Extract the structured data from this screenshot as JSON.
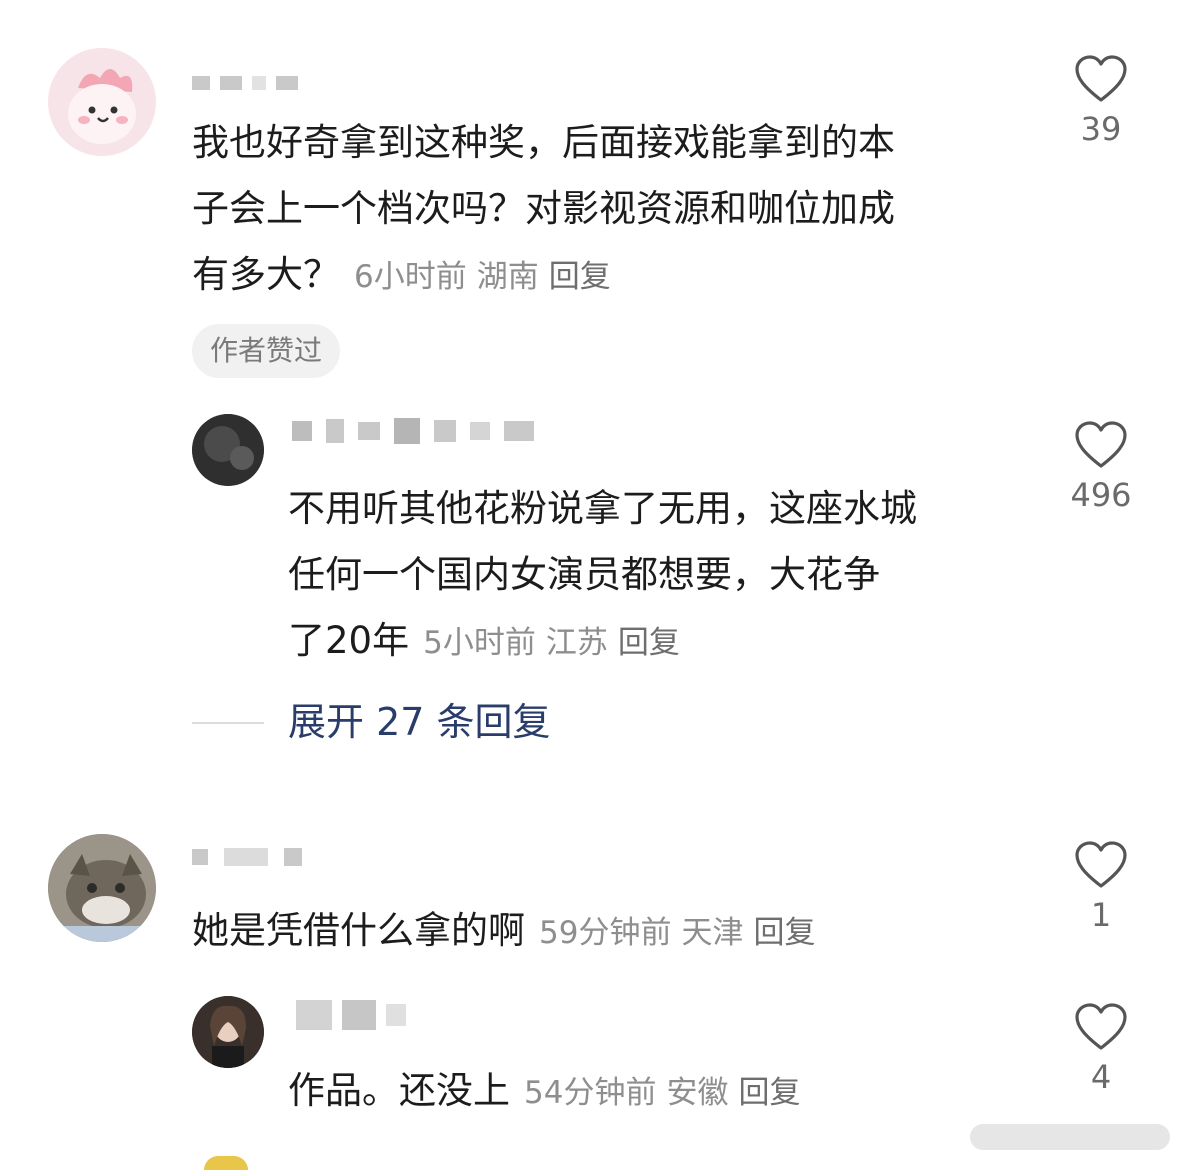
{
  "comments": [
    {
      "text_lines": [
        "我也好奇拿到这种奖，后面接戏能拿到的本",
        "子会上一个档次吗？对影视资源和咖位加成",
        "有多大？"
      ],
      "time": "6小时前",
      "location": "湖南",
      "reply_label": "回复",
      "likes": "39",
      "badge": "作者赞过",
      "avatar_icon": "pink-cartoon-avatar"
    },
    {
      "text_lines": [
        "不用听其他花粉说拿了无用，这座水城",
        "任何一个国内女演员都想要，大花争",
        "了20年"
      ],
      "time": "5小时前",
      "location": "江苏",
      "reply_label": "回复",
      "likes": "496",
      "avatar_icon": "dark-avatar"
    },
    {
      "text_lines": [
        "她是凭借什么拿的啊"
      ],
      "time": "59分钟前",
      "location": "天津",
      "reply_label": "回复",
      "likes": "1",
      "avatar_icon": "cat-avatar"
    },
    {
      "text_lines": [
        "作品。还没上"
      ],
      "time": "54分钟前",
      "location": "安徽",
      "reply_label": "回复",
      "likes": "4",
      "avatar_icon": "girl-avatar"
    }
  ],
  "expand_replies": "展开 27 条回复",
  "colors": {
    "text": "#1c1c1c",
    "meta": "#8e8e8e",
    "link": "#2a3c6a",
    "chip_bg": "#f1f1f1"
  }
}
